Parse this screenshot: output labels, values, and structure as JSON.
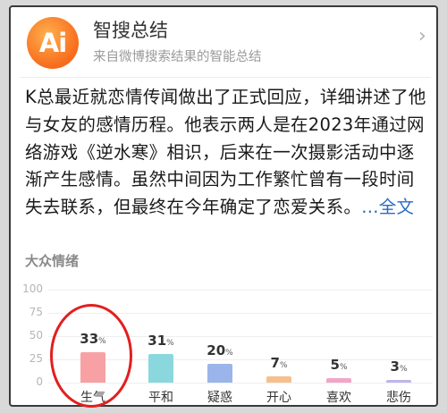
{
  "header": {
    "logo_text": "Ai",
    "title": "智搜总结",
    "subtitle": "来自微博搜索结果的智能总结"
  },
  "body": {
    "text": "K总最近就恋情传闻做出了正式回应，详细讲述了他与女友的感情历程。他表示两人是在2023年通过网络游戏《逆水寒》相识，后来在一次摄影活动中逐渐产生感情。虽然中间因为工作繁忙曾有一段时间失去联系，但最终在今年确定了恋爱关系。",
    "more_link": "...全文"
  },
  "sentiment": {
    "title": "大众情绪",
    "highlighted_category": "生气",
    "chart_data": {
      "type": "bar",
      "categories": [
        "生气",
        "平和",
        "疑惑",
        "开心",
        "喜欢",
        "悲伤"
      ],
      "values": [
        33,
        31,
        20,
        7,
        5,
        3
      ],
      "unit": "%",
      "ylim": [
        0,
        100
      ],
      "yticks": [
        100,
        75,
        50,
        25,
        0
      ],
      "colors": [
        "#f7a1a5",
        "#8ad8de",
        "#9bb4ea",
        "#f6c08e",
        "#f1a6c8",
        "#c0b4ec"
      ]
    }
  }
}
